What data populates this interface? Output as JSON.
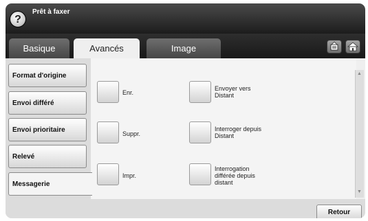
{
  "title": "Prêt à faxer",
  "help_icon": "?",
  "tabs": [
    {
      "label": "Basique",
      "active": false
    },
    {
      "label": "Avancés",
      "active": true
    },
    {
      "label": "Image",
      "active": false
    }
  ],
  "toolbar_icons": [
    "job-status-icon",
    "home-icon"
  ],
  "nav": [
    {
      "label": "Format d'origine",
      "selected": false
    },
    {
      "label": "Envoi différé",
      "selected": false
    },
    {
      "label": "Envoi prioritaire",
      "selected": false
    },
    {
      "label": "Relevé",
      "selected": false
    },
    {
      "label": "Messagerie",
      "selected": true
    }
  ],
  "options": {
    "left": [
      "Enr.",
      "Suppr.",
      "Impr."
    ],
    "right": [
      [
        "Envoyer vers",
        "Distant"
      ],
      [
        "Interroger depuis",
        "Distant"
      ],
      [
        "Interrogation",
        "différée depuis",
        "distant"
      ]
    ]
  },
  "back_label": "Retour",
  "colors": {
    "title_bar": "#2b2b2b",
    "panel": "#f4f4f4"
  }
}
